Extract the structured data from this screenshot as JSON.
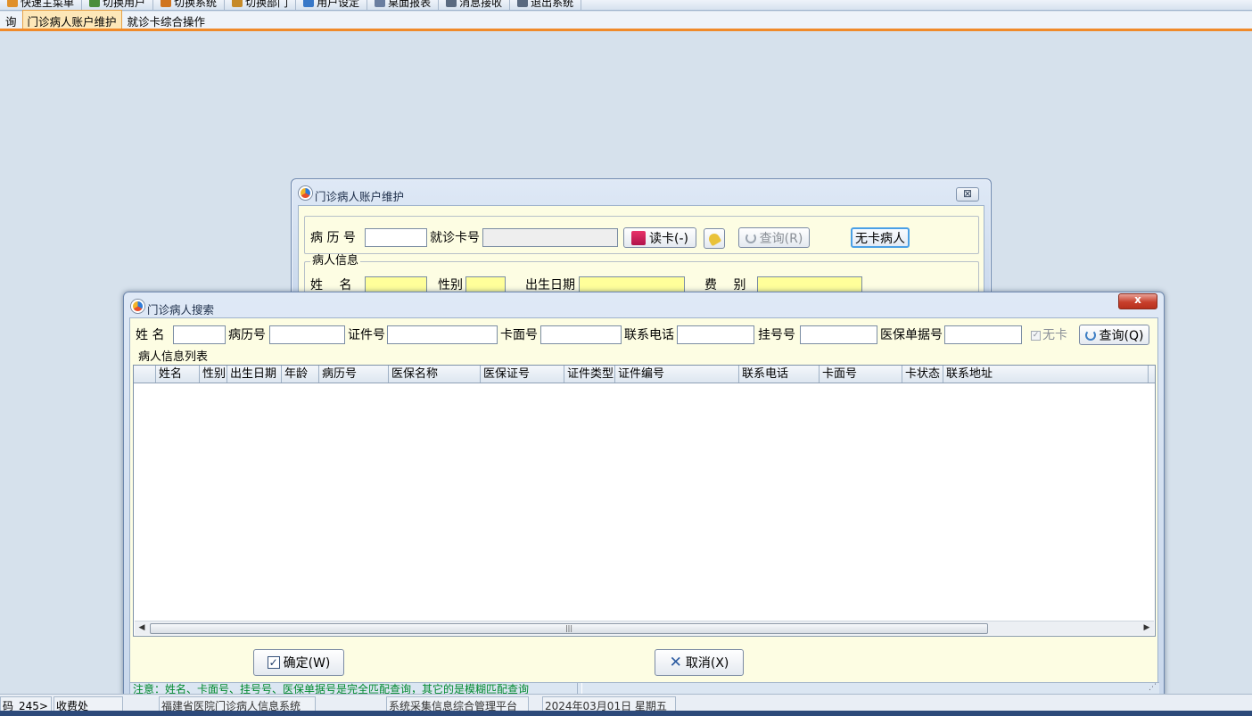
{
  "toolbar": {
    "items": [
      {
        "label": "快速主菜单",
        "icon": "home-icon",
        "color": "#e0902a"
      },
      {
        "label": "切换用户",
        "icon": "user-icon",
        "color": "#4a8e3a"
      },
      {
        "label": "切换系统",
        "icon": "system-icon",
        "color": "#d0741e"
      },
      {
        "label": "切换部门",
        "icon": "dept-icon",
        "color": "#c68a28"
      },
      {
        "label": "用户设定",
        "icon": "settings-icon",
        "color": "#3878c8"
      },
      {
        "label": "桌面报表",
        "icon": "report-icon",
        "color": "#6a7ea0"
      },
      {
        "label": "消息接收",
        "icon": "message-icon",
        "color": "#5a6a80"
      },
      {
        "label": "退出系统",
        "icon": "exit-icon",
        "color": "#5a6a80"
      }
    ]
  },
  "tabs": [
    {
      "label": "询"
    },
    {
      "label": "门诊病人账户维护",
      "active": true
    },
    {
      "label": "就诊卡综合操作"
    }
  ],
  "status": {
    "cell1": "码_245>",
    "cell2": "收费处",
    "cell3": "福建省医院门诊病人信息系统",
    "cell4": "系统采集信息综合管理平台",
    "cell5": "2024年03月01日 星期五"
  },
  "account_window": {
    "title": "门诊病人账户维护",
    "close_label": "⊠",
    "record_no_label": "病 历 号",
    "record_no_value": "",
    "card_no_label": "就诊卡号",
    "card_no_value": "",
    "read_card_label": "读卡(-)",
    "query_label": "查询(R)",
    "no_card_label": "无卡病人",
    "patient_group_label": "病人信息",
    "name_label": "姓　 名",
    "gender_label": "性别",
    "birth_label": "出生日期",
    "fee_label": "费　 别"
  },
  "search_window": {
    "title": "门诊病人搜索",
    "close_label": "x",
    "fields": {
      "name_label": "姓 名",
      "record_label": "病历号",
      "id_label": "证件号",
      "card_label": "卡面号",
      "phone_label": "联系电话",
      "reg_label": "挂号号",
      "ins_label": "医保单据号",
      "no_card_label": "无卡",
      "no_card_checked": true,
      "query_label": "查询(Q)"
    },
    "list_group_label": "病人信息列表",
    "columns": [
      "姓名",
      "性别",
      "出生日期",
      "年龄",
      "病历号",
      "医保名称",
      "医保证号",
      "证件类型",
      "证件编号",
      "联系电话",
      "卡面号",
      "卡状态",
      "联系地址"
    ],
    "ok_label": "确定(W)",
    "cancel_label": "取消(X)",
    "note": "注意：姓名、卡面号、挂号号、医保单据号是完全匹配查询，其它的是模糊匹配查询"
  }
}
